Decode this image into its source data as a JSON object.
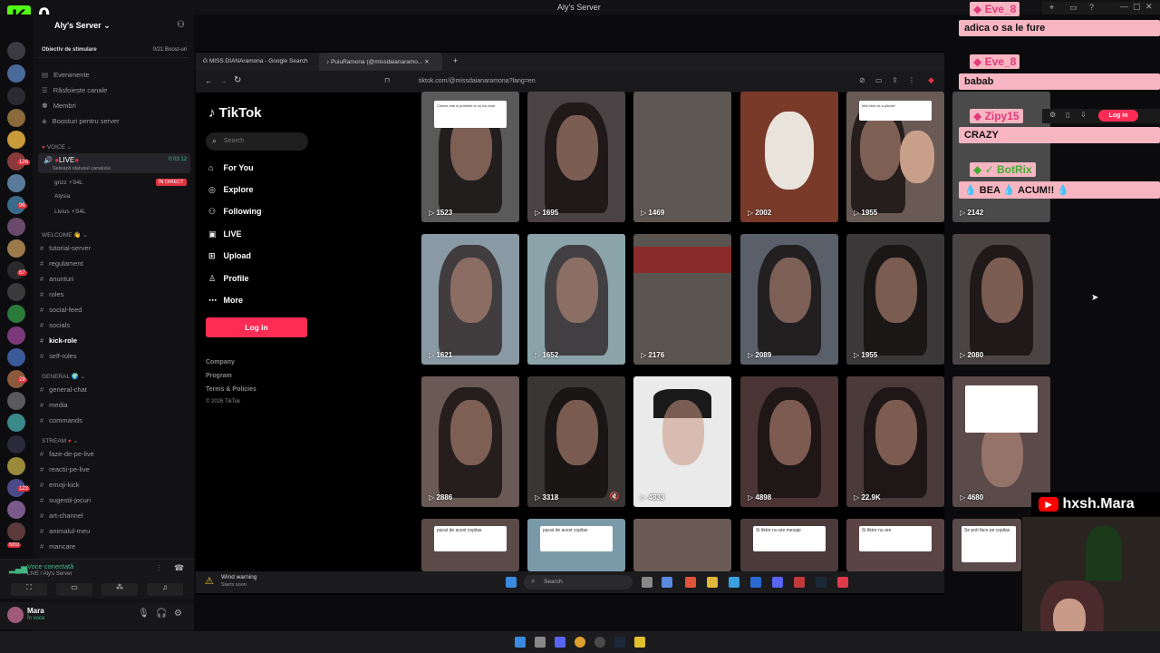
{
  "window": {
    "title": "Aly's Server"
  },
  "kick": {
    "count": "0",
    "logo": "K"
  },
  "discord": {
    "server_name": "Aly's Server",
    "boost": {
      "label": "Obiectiv de stimulare",
      "progress": "0/21 Boost-uri"
    },
    "menu": [
      "Evenimente",
      "Răsfoiește canale",
      "Membri",
      "Boosturi pentru server"
    ],
    "voice_category": "VOICE",
    "live_channel": {
      "name": "LIVE",
      "timer": "0:03:12",
      "status": "Setează statusul canalului",
      "badge": "ÎN DIRECT"
    },
    "voice_users": [
      "grizz ⚡S4L",
      "Alysia",
      "Livius ⚡S4L"
    ],
    "welcome_category": "WELCOME",
    "welcome_channels": [
      "tutorial-server",
      "regulament",
      "anunturi",
      "roles",
      "social-feed",
      "socials",
      "kick-role",
      "self-roles"
    ],
    "general_category": "GENERAL",
    "general_channels": [
      "general-chat",
      "media",
      "commands"
    ],
    "stream_category": "STREAM",
    "stream_channels": [
      "faze-de-pe-live",
      "reactii-pe-live",
      "emoji-kick",
      "sugestii-jocuri",
      "art-channel",
      "animalul-meu",
      "mancare"
    ],
    "voice_connected": {
      "title": "Voce conectată",
      "sub": "LIVE / Aly's Server"
    },
    "user": {
      "name": "Mara",
      "status": "În voce"
    },
    "rail_badges": [
      "126",
      "96",
      "67",
      "29",
      "123",
      "NOU"
    ]
  },
  "browser": {
    "tabs": [
      "MISS.DIANAramona - Google Search",
      "PuiuRamona (@missdaianaramo..."
    ],
    "url": "tiktok.com/@missdaianaramona?lang=en"
  },
  "tiktok": {
    "logo": "TikTok",
    "search_placeholder": "Search",
    "nav": [
      "For You",
      "Explore",
      "Following",
      "LIVE",
      "Upload",
      "Profile",
      "More"
    ],
    "login": "Log in",
    "footer": [
      "Company",
      "Program",
      "Terms & Policies",
      "© 2026 TikTok"
    ],
    "rows": [
      [
        "1523",
        "1695",
        "1469",
        "2002",
        "1955",
        "2142"
      ],
      [
        "1621",
        "1652",
        "2176",
        "2089",
        "1955",
        "2080"
      ],
      [
        "2886",
        "3318",
        "4833",
        "4898",
        "22.9K",
        "4680"
      ]
    ],
    "bottom_captions": [
      "pacat de acest copilas",
      "pacat de acest copilas",
      "",
      "Si tiktor nu are mesaje",
      "Si tiktor nu are",
      "Se poti face pe copilas"
    ],
    "top_captions": [
      "Cineva mai si proteste si nu ea voce",
      "",
      "",
      "",
      "Mai bine ca a plecat!",
      ""
    ],
    "weather": {
      "title": "Wind warning",
      "sub": "Starts soon"
    },
    "taskbar_search": "Search"
  },
  "chat": [
    {
      "user": "Eve_8",
      "message": "adica o sa le fure"
    },
    {
      "user": "Eve_8",
      "message": "babab"
    },
    {
      "user": "Zipy15",
      "message": "CRAZY"
    },
    {
      "user": "BotRix",
      "message": "💧 BEA 💧 ACUM!! 💧"
    }
  ],
  "chat_login": "Log in",
  "youtube_handle": "hxsh.Mara"
}
